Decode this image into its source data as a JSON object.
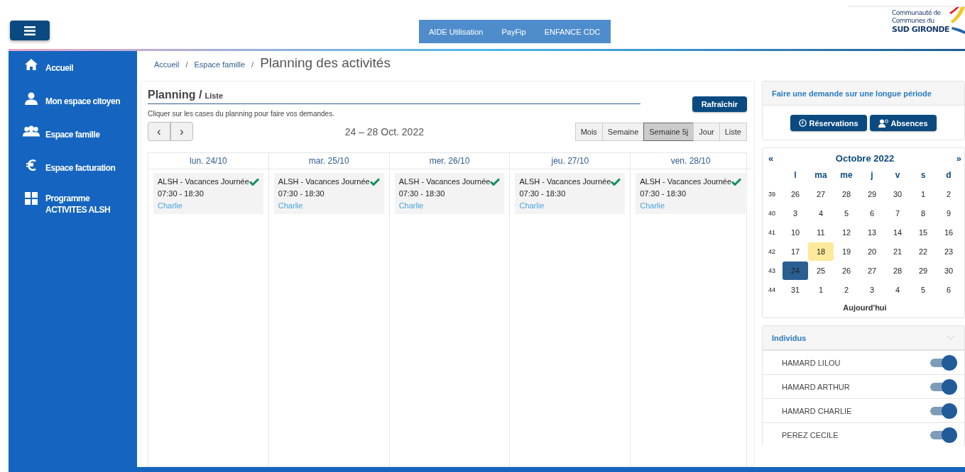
{
  "header": {
    "nav": [
      "AIDE Utilisation",
      "PayFip",
      "ENFANCE CDC"
    ],
    "logo": [
      "Communauté de",
      "Communes du",
      "SUD GIRONDE"
    ]
  },
  "sidebar": {
    "items": [
      {
        "label": "Accueil",
        "kind": "home"
      },
      {
        "label": "Mon espace citoyen",
        "kind": "user"
      },
      {
        "label": "Espace famille",
        "kind": "family"
      },
      {
        "label": "Espace facturation",
        "kind": "euro"
      },
      {
        "label": "Programme ACTIVITES ALSH",
        "kind": "grid"
      }
    ]
  },
  "breadcrumb": {
    "links": [
      "Accueil",
      "Espace famille"
    ],
    "separators": [
      "/",
      "/"
    ],
    "current": "Planning des activités"
  },
  "planning": {
    "title": "Planning /",
    "subtitle": "Liste",
    "refresh": "Rafraîchir",
    "hint": "Cliquer sur les cases du planning pour faire vos demandes.",
    "nav": [
      "‹",
      "›"
    ],
    "range": "24 – 28 Oct. 2022",
    "views": [
      {
        "label": "Mois",
        "selected": false
      },
      {
        "label": "Semaine",
        "selected": false
      },
      {
        "label": "Semaine 5j",
        "selected": true
      },
      {
        "label": "Jour",
        "selected": false
      },
      {
        "label": "Liste",
        "selected": false
      }
    ],
    "columns": [
      {
        "day": "lun. 24/10",
        "events": [
          {
            "title": "ALSH - Vacances Journée",
            "time": "07:30 - 18:30",
            "child": "Charlie",
            "confirmed": true
          }
        ]
      },
      {
        "day": "mar. 25/10",
        "events": [
          {
            "title": "ALSH - Vacances Journée",
            "time": "07:30 - 18:30",
            "child": "Charlie",
            "confirmed": true
          }
        ]
      },
      {
        "day": "mer. 26/10",
        "events": [
          {
            "title": "ALSH - Vacances Journée",
            "time": "07:30 - 18:30",
            "child": "Charlie",
            "confirmed": true
          }
        ]
      },
      {
        "day": "jeu. 27/10",
        "events": [
          {
            "title": "ALSH - Vacances Journée",
            "time": "07:30 - 18:30",
            "child": "Charlie",
            "confirmed": true
          }
        ]
      },
      {
        "day": "ven. 28/10",
        "events": [
          {
            "title": "ALSH - Vacances Journée",
            "time": "07:30 - 18:30",
            "child": "Charlie",
            "confirmed": true
          }
        ]
      }
    ]
  },
  "long_period": {
    "title": "Faire une demande sur une longue période",
    "buttons": [
      {
        "label": "Réservations",
        "kind": "clock"
      },
      {
        "label": "Absences",
        "kind": "person"
      }
    ]
  },
  "calendar": {
    "prev": "«",
    "month": "Octobre 2022",
    "next": "»",
    "weekdays": [
      "l",
      "ma",
      "me",
      "j",
      "v",
      "s",
      "d"
    ],
    "today_button": "Aujourd'hui",
    "weeks": [
      {
        "week": "39",
        "days": [
          {
            "label": "26",
            "selected": false,
            "today": false
          },
          {
            "label": "27",
            "selected": false,
            "today": false
          },
          {
            "label": "28",
            "selected": false,
            "today": false
          },
          {
            "label": "29",
            "selected": false,
            "today": false
          },
          {
            "label": "30",
            "selected": false,
            "today": false
          },
          {
            "label": "1",
            "selected": false,
            "today": false
          },
          {
            "label": "2",
            "selected": false,
            "today": false
          }
        ]
      },
      {
        "week": "40",
        "days": [
          {
            "label": "3",
            "selected": false,
            "today": false
          },
          {
            "label": "4",
            "selected": false,
            "today": false
          },
          {
            "label": "5",
            "selected": false,
            "today": false
          },
          {
            "label": "6",
            "selected": false,
            "today": false
          },
          {
            "label": "7",
            "selected": false,
            "today": false
          },
          {
            "label": "8",
            "selected": false,
            "today": false
          },
          {
            "label": "9",
            "selected": false,
            "today": false
          }
        ]
      },
      {
        "week": "41",
        "days": [
          {
            "label": "10",
            "selected": false,
            "today": false
          },
          {
            "label": "11",
            "selected": false,
            "today": false
          },
          {
            "label": "12",
            "selected": false,
            "today": false
          },
          {
            "label": "13",
            "selected": false,
            "today": false
          },
          {
            "label": "14",
            "selected": false,
            "today": false
          },
          {
            "label": "15",
            "selected": false,
            "today": false
          },
          {
            "label": "16",
            "selected": false,
            "today": false
          }
        ]
      },
      {
        "week": "42",
        "days": [
          {
            "label": "17",
            "selected": false,
            "today": false
          },
          {
            "label": "18",
            "selected": false,
            "today": true
          },
          {
            "label": "19",
            "selected": false,
            "today": false
          },
          {
            "label": "20",
            "selected": false,
            "today": false
          },
          {
            "label": "21",
            "selected": false,
            "today": false
          },
          {
            "label": "22",
            "selected": false,
            "today": false
          },
          {
            "label": "23",
            "selected": false,
            "today": false
          }
        ]
      },
      {
        "week": "43",
        "days": [
          {
            "label": "24",
            "selected": true,
            "today": false
          },
          {
            "label": "25",
            "selected": false,
            "today": false
          },
          {
            "label": "26",
            "selected": false,
            "today": false
          },
          {
            "label": "27",
            "selected": false,
            "today": false
          },
          {
            "label": "28",
            "selected": false,
            "today": false
          },
          {
            "label": "29",
            "selected": false,
            "today": false
          },
          {
            "label": "30",
            "selected": false,
            "today": false
          }
        ]
      },
      {
        "week": "44",
        "days": [
          {
            "label": "31",
            "selected": false,
            "today": false
          },
          {
            "label": "1",
            "selected": false,
            "today": false
          },
          {
            "label": "2",
            "selected": false,
            "today": false
          },
          {
            "label": "3",
            "selected": false,
            "today": false
          },
          {
            "label": "4",
            "selected": false,
            "today": false
          },
          {
            "label": "5",
            "selected": false,
            "today": false
          },
          {
            "label": "6",
            "selected": false,
            "today": false
          }
        ]
      }
    ]
  },
  "individus": {
    "title": "Individus",
    "expanded": true,
    "people": [
      {
        "name": "HAMARD LILOU",
        "on": true
      },
      {
        "name": "HAMARD ARTHUR",
        "on": true
      },
      {
        "name": "HAMARD CHARLIE",
        "on": true
      },
      {
        "name": "PEREZ CECILE",
        "on": true
      }
    ]
  }
}
